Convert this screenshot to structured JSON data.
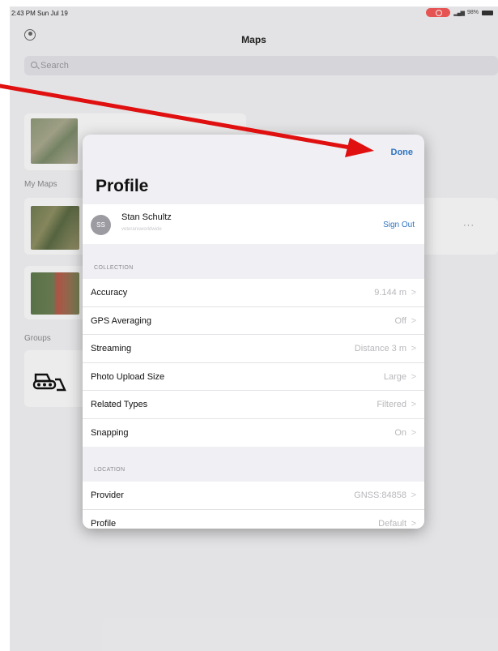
{
  "status_bar": {
    "time": "2:43 PM  Sun Jul 19",
    "battery": "98%"
  },
  "nav": {
    "title": "Maps",
    "account_icon": "person-circle-icon"
  },
  "search": {
    "placeholder": "Search"
  },
  "sections": {
    "my_maps": "My Maps",
    "groups": "Groups"
  },
  "modal": {
    "done_label": "Done",
    "title": "Profile",
    "user": {
      "initials": "SS",
      "name": "Stan Schultz",
      "subtitle": "veteransworldwide",
      "sign_out_label": "Sign Out"
    },
    "collection_header": "COLLECTION",
    "collection_rows": [
      {
        "label": "Accuracy",
        "value": "9.144 m"
      },
      {
        "label": "GPS Averaging",
        "value": "Off"
      },
      {
        "label": "Streaming",
        "value": "Distance 3 m"
      },
      {
        "label": "Photo Upload Size",
        "value": "Large"
      },
      {
        "label": "Related Types",
        "value": "Filtered"
      },
      {
        "label": "Snapping",
        "value": "On"
      }
    ],
    "location_header": "LOCATION",
    "location_rows": [
      {
        "label": "Provider",
        "value": "GNSS:84858"
      },
      {
        "label": "Profile",
        "value": "Default"
      }
    ]
  },
  "colors": {
    "accent": "#2f74c0",
    "annotation_arrow": "#e01010",
    "record_pill": "#f55959"
  }
}
